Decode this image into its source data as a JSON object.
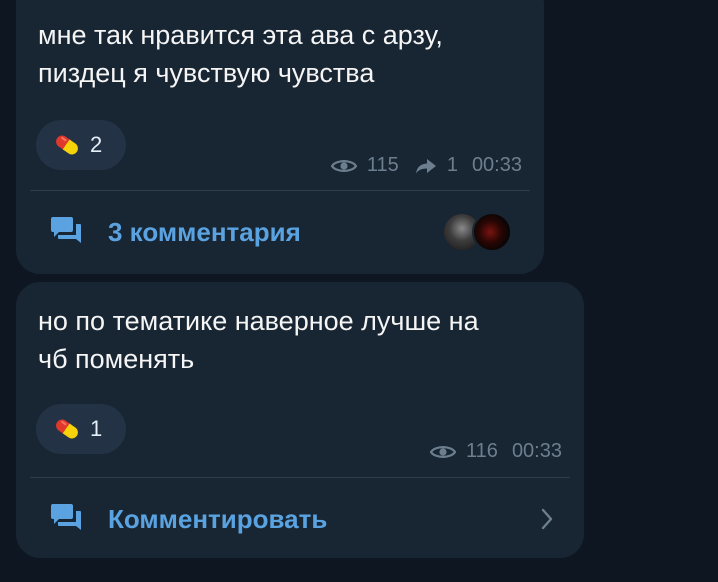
{
  "messages": [
    {
      "text": "мне так нравится эта ава с арзу,\nпиздец я чувствую чувства",
      "reaction": {
        "icon": "pill-icon",
        "count": "2"
      },
      "views": "115",
      "forwards": "1",
      "time": "00:33",
      "comments": {
        "label": "3 комментария",
        "avatars": [
          "commenter-avatar",
          "commenter-avatar"
        ]
      }
    },
    {
      "text": "но по тематике наверное лучше на\nчб поменять",
      "reaction": {
        "icon": "pill-icon",
        "count": "1"
      },
      "views": "116",
      "time": "00:33",
      "comments": {
        "label": "Комментировать",
        "icon": "chevron-right-icon"
      }
    }
  ],
  "colors": {
    "background": "#0e1621",
    "bubble": "#182533",
    "reaction_bg": "#233244",
    "text": "#f5f5f5",
    "meta": "#6d7f8f",
    "link": "#5aa3e0",
    "pill_red": "#e0392b",
    "pill_yellow": "#f5d20a"
  },
  "icons": {
    "views": "eye-icon",
    "forward": "forward-arrow-icon",
    "comments": "comments-icon"
  }
}
